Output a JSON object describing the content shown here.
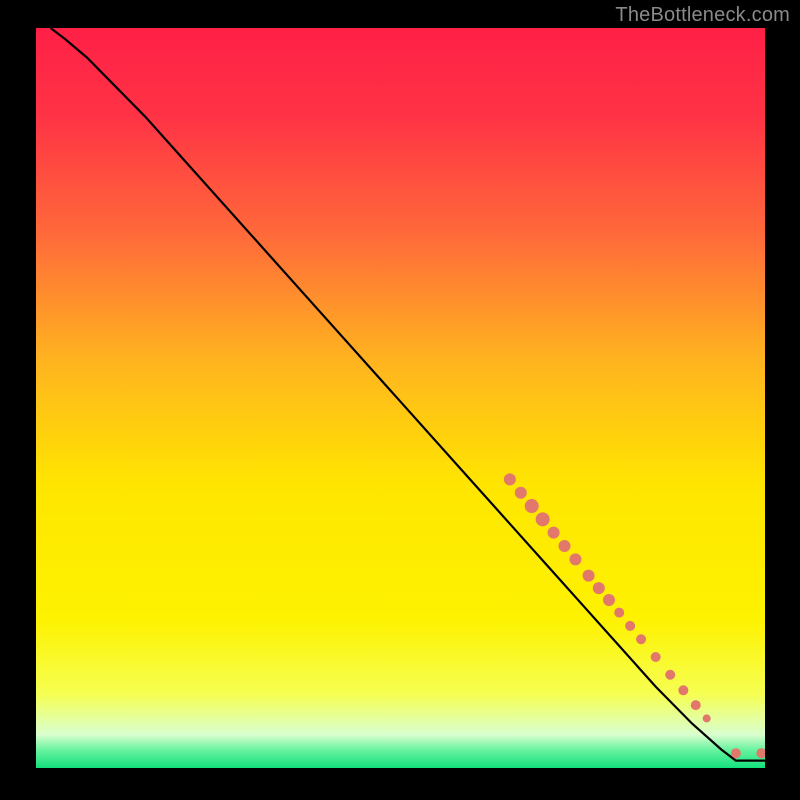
{
  "attribution": "TheBottleneck.com",
  "chart_data": {
    "type": "line",
    "title": "",
    "xlabel": "",
    "ylabel": "",
    "xlim": [
      0,
      100
    ],
    "ylim": [
      0,
      100
    ],
    "background_gradient_stops": [
      {
        "offset": 0.0,
        "color": "#ff2046"
      },
      {
        "offset": 0.12,
        "color": "#ff3345"
      },
      {
        "offset": 0.28,
        "color": "#ff6a3a"
      },
      {
        "offset": 0.45,
        "color": "#ffb41f"
      },
      {
        "offset": 0.62,
        "color": "#ffe600"
      },
      {
        "offset": 0.8,
        "color": "#fdf200"
      },
      {
        "offset": 0.9,
        "color": "#f6ff52"
      },
      {
        "offset": 0.955,
        "color": "#d9ffcf"
      },
      {
        "offset": 0.975,
        "color": "#6bf3a0"
      },
      {
        "offset": 1.0,
        "color": "#13e07d"
      }
    ],
    "series": [
      {
        "name": "curve",
        "type": "line",
        "color": "#000000",
        "x": [
          2,
          4,
          7,
          10,
          15,
          20,
          30,
          40,
          50,
          60,
          65,
          70,
          75,
          80,
          85,
          90,
          94,
          96,
          98,
          100
        ],
        "y": [
          100,
          98.5,
          96,
          93,
          88,
          82.5,
          71.5,
          60.5,
          49.5,
          38.5,
          33,
          27.5,
          22,
          16.5,
          11,
          6,
          2.5,
          1,
          1,
          1
        ]
      },
      {
        "name": "highlighted-points",
        "type": "scatter",
        "color": "#e2776b",
        "points": [
          {
            "x": 65.0,
            "y": 39.0,
            "r": 6
          },
          {
            "x": 66.5,
            "y": 37.2,
            "r": 6
          },
          {
            "x": 68.0,
            "y": 35.4,
            "r": 7
          },
          {
            "x": 69.5,
            "y": 33.6,
            "r": 7
          },
          {
            "x": 71.0,
            "y": 31.8,
            "r": 6
          },
          {
            "x": 72.5,
            "y": 30.0,
            "r": 6
          },
          {
            "x": 74.0,
            "y": 28.2,
            "r": 6
          },
          {
            "x": 75.8,
            "y": 26.0,
            "r": 6
          },
          {
            "x": 77.2,
            "y": 24.3,
            "r": 6
          },
          {
            "x": 78.6,
            "y": 22.7,
            "r": 6
          },
          {
            "x": 80.0,
            "y": 21.0,
            "r": 5
          },
          {
            "x": 81.5,
            "y": 19.2,
            "r": 5
          },
          {
            "x": 83.0,
            "y": 17.4,
            "r": 5
          },
          {
            "x": 85.0,
            "y": 15.0,
            "r": 5
          },
          {
            "x": 87.0,
            "y": 12.6,
            "r": 5
          },
          {
            "x": 88.8,
            "y": 10.5,
            "r": 5
          },
          {
            "x": 90.5,
            "y": 8.5,
            "r": 5
          },
          {
            "x": 92.0,
            "y": 6.7,
            "r": 4
          },
          {
            "x": 96.0,
            "y": 2.0,
            "r": 5
          },
          {
            "x": 99.5,
            "y": 2.0,
            "r": 5
          }
        ]
      }
    ]
  }
}
